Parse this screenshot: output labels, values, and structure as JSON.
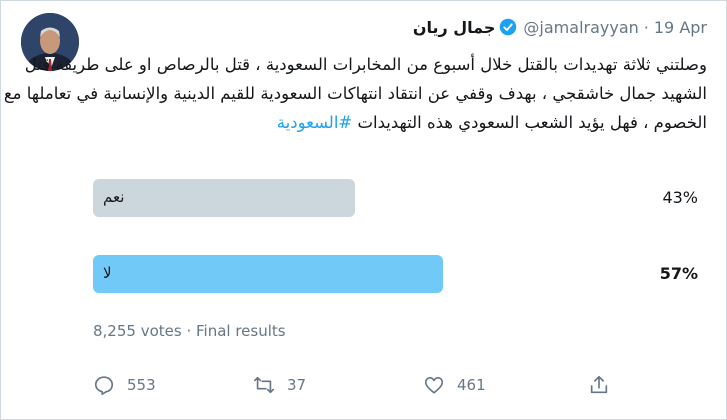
{
  "tweet": {
    "display_name": "جمال ريان",
    "handle": "@jamalrayyan",
    "separator": "·",
    "date": "19 Apr",
    "text_lines": [
      "وصلتني ثلاثة تهديدات بالقتل خلال أسبوع من المخابرات السعودية ، قتل بالرصاص او على طريقة قتل",
      "الشهيد جمال خاشقجي ، بهدف وقفي عن انتقاد انتهاكات السعودية للقيم الدينية والإنسانية في تعاملها مع"
    ],
    "last_line_text": "الخصوم ، فهل يؤيد الشعب السعودي هذه التهديدات",
    "hashtag": "#السعودية"
  },
  "poll": {
    "options": [
      {
        "label": "نعم",
        "percent": "43%",
        "value": 43
      },
      {
        "label": "لا",
        "percent": "57%",
        "value": 57
      }
    ],
    "votes_text": "8,255 votes · Final results"
  },
  "actions": {
    "replies": "553",
    "retweets": "37",
    "likes": "461"
  },
  "icons": [
    "verified-icon",
    "reply-icon",
    "retweet-icon",
    "like-icon",
    "share-icon"
  ],
  "colors": {
    "accent": "#1da1f2",
    "winner_bar": "#71c9f8",
    "loser_bar": "#ccd6dd",
    "muted": "#657786"
  }
}
